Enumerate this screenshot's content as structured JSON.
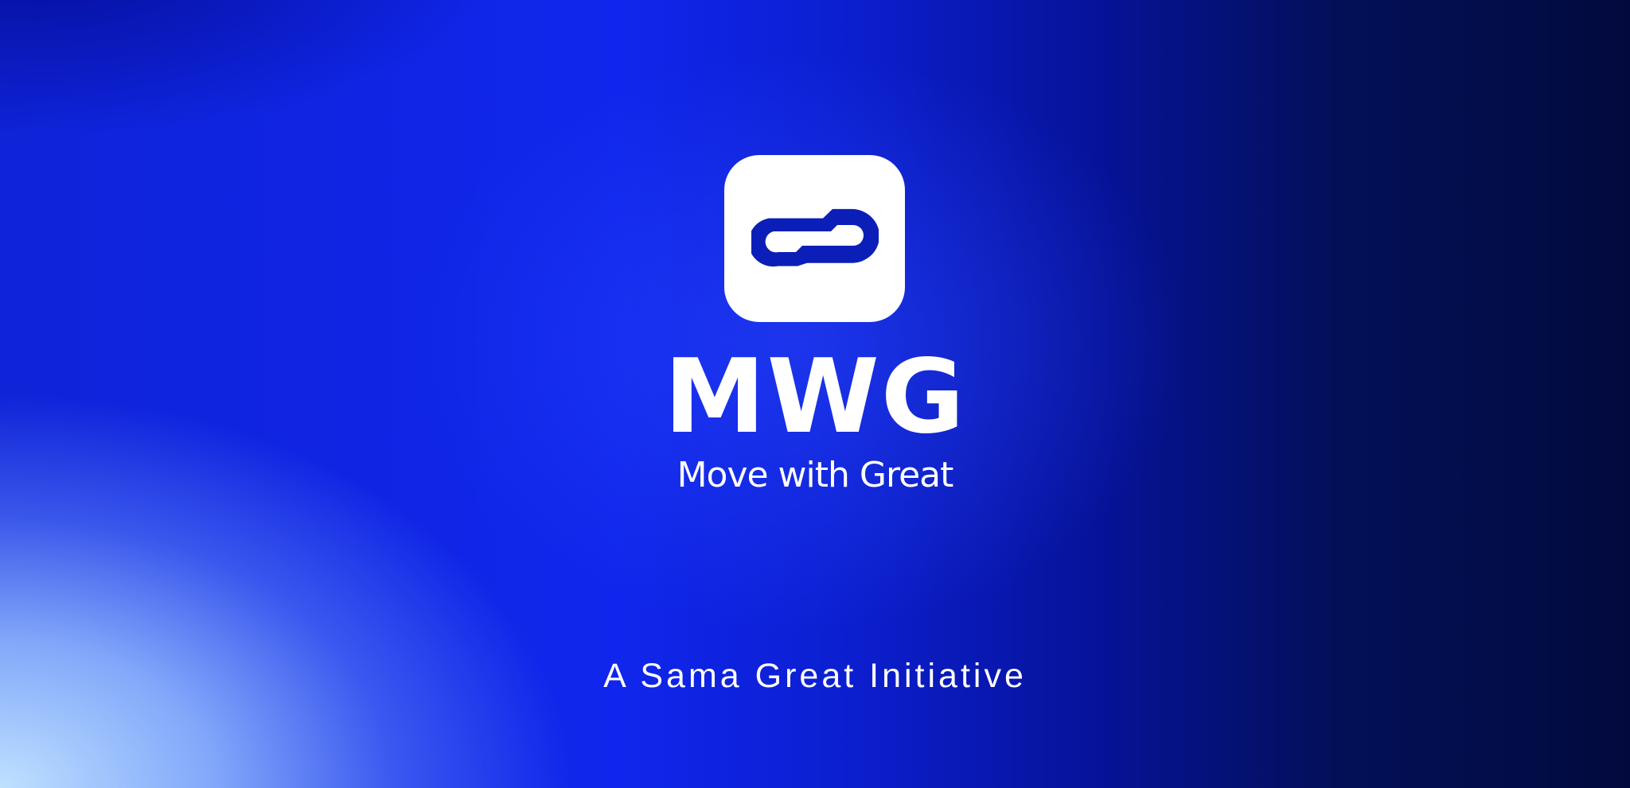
{
  "brand": {
    "logo_icon": "link-chain-icon",
    "wordmark": "MWG",
    "tagline": "Move with Great",
    "initiative": "A Sama Great Initiative"
  },
  "colors": {
    "primary_blue": "#1026ec",
    "deep_navy": "#020a3d",
    "light_sky": "#bee1ff",
    "white": "#ffffff"
  }
}
